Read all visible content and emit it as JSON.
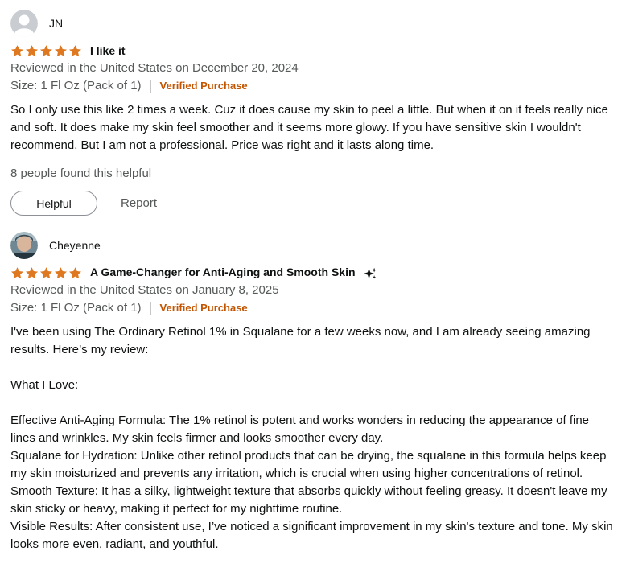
{
  "reviews": [
    {
      "profile_name": "JN",
      "avatar": "default-user-icon",
      "rating": 5,
      "title": "I like it",
      "reviewed_line": "Reviewed in the United States on December 20, 2024",
      "size": "Size: 1 Fl Oz (Pack of 1)",
      "verified": "Verified Purchase",
      "body": [
        "So I only use this like 2 times a week. Cuz it does cause my skin to peel a little. But when it on it feels really nice and soft. It does make my skin feel smoother and it seems more glowy. If you have sensitive skin I wouldn't recommend. But I am not a professional. Price was right and it lasts along time."
      ],
      "helpful_count": "8 people found this helpful",
      "helpful_label": "Helpful",
      "report_label": "Report"
    },
    {
      "profile_name": "Cheyenne",
      "avatar": "user-photo",
      "rating": 5,
      "title": "A Game-Changer for Anti-Aging and Smooth Skin",
      "title_icon": "sparkles-icon",
      "reviewed_line": "Reviewed in the United States on January 8, 2025",
      "size": "Size: 1 Fl Oz (Pack of 1)",
      "verified": "Verified Purchase",
      "body": [
        "I've been using The Ordinary Retinol 1% in Squalane for a few weeks now, and I am already seeing amazing results. Here’s my review:",
        "",
        "What I Love:",
        "",
        "Effective Anti-Aging Formula: The 1% retinol is potent and works wonders in reducing the appearance of fine lines and wrinkles. My skin feels firmer and looks smoother every day.",
        "Squalane for Hydration: Unlike other retinol products that can be drying, the squalane in this formula helps keep my skin moisturized and prevents any irritation, which is crucial when using higher concentrations of retinol.",
        "Smooth Texture: It has a silky, lightweight texture that absorbs quickly without feeling greasy. It doesn't leave my skin sticky or heavy, making it perfect for my nighttime routine.",
        "Visible Results: After consistent use, I’ve noticed a significant improvement in my skin's texture and tone. My skin looks more even, radiant, and youthful."
      ]
    }
  ],
  "colors": {
    "star": "#de7921",
    "verified": "#c45500",
    "secondary_text": "#565959"
  }
}
